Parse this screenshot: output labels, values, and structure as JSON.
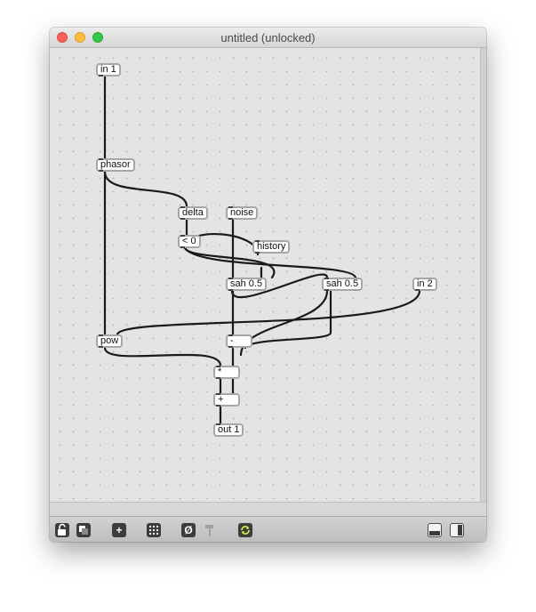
{
  "window": {
    "title": "untitled (unlocked)"
  },
  "objects": {
    "in1": "in 1",
    "phasor": "phasor",
    "delta": "delta",
    "noise": "noise",
    "lt0": "< 0",
    "history": "history",
    "sah_a": "sah 0.5",
    "sah_b": "sah 0.5",
    "in2": "in 2",
    "pow": "pow",
    "minus": "-",
    "mult": "*",
    "plus": "+",
    "out1": "out 1"
  },
  "toolbar": {
    "lock_icon": "lock-icon",
    "presentation_icon": "presentation-icon",
    "new_object_label": "+",
    "grid_icon": "grid-icon",
    "no_icon": "Ø",
    "hammer_icon": "hammer-icon",
    "refresh_icon": "refresh-icon",
    "bottom_panel_icon": "bottom-panel-icon",
    "side_panel_icon": "side-panel-icon"
  },
  "colors": {
    "canvas": "#e4e4e4",
    "patchcord": "#1a1a1a",
    "object_border": "#a6a6a6",
    "refresh_accent": "#c9e84a"
  }
}
